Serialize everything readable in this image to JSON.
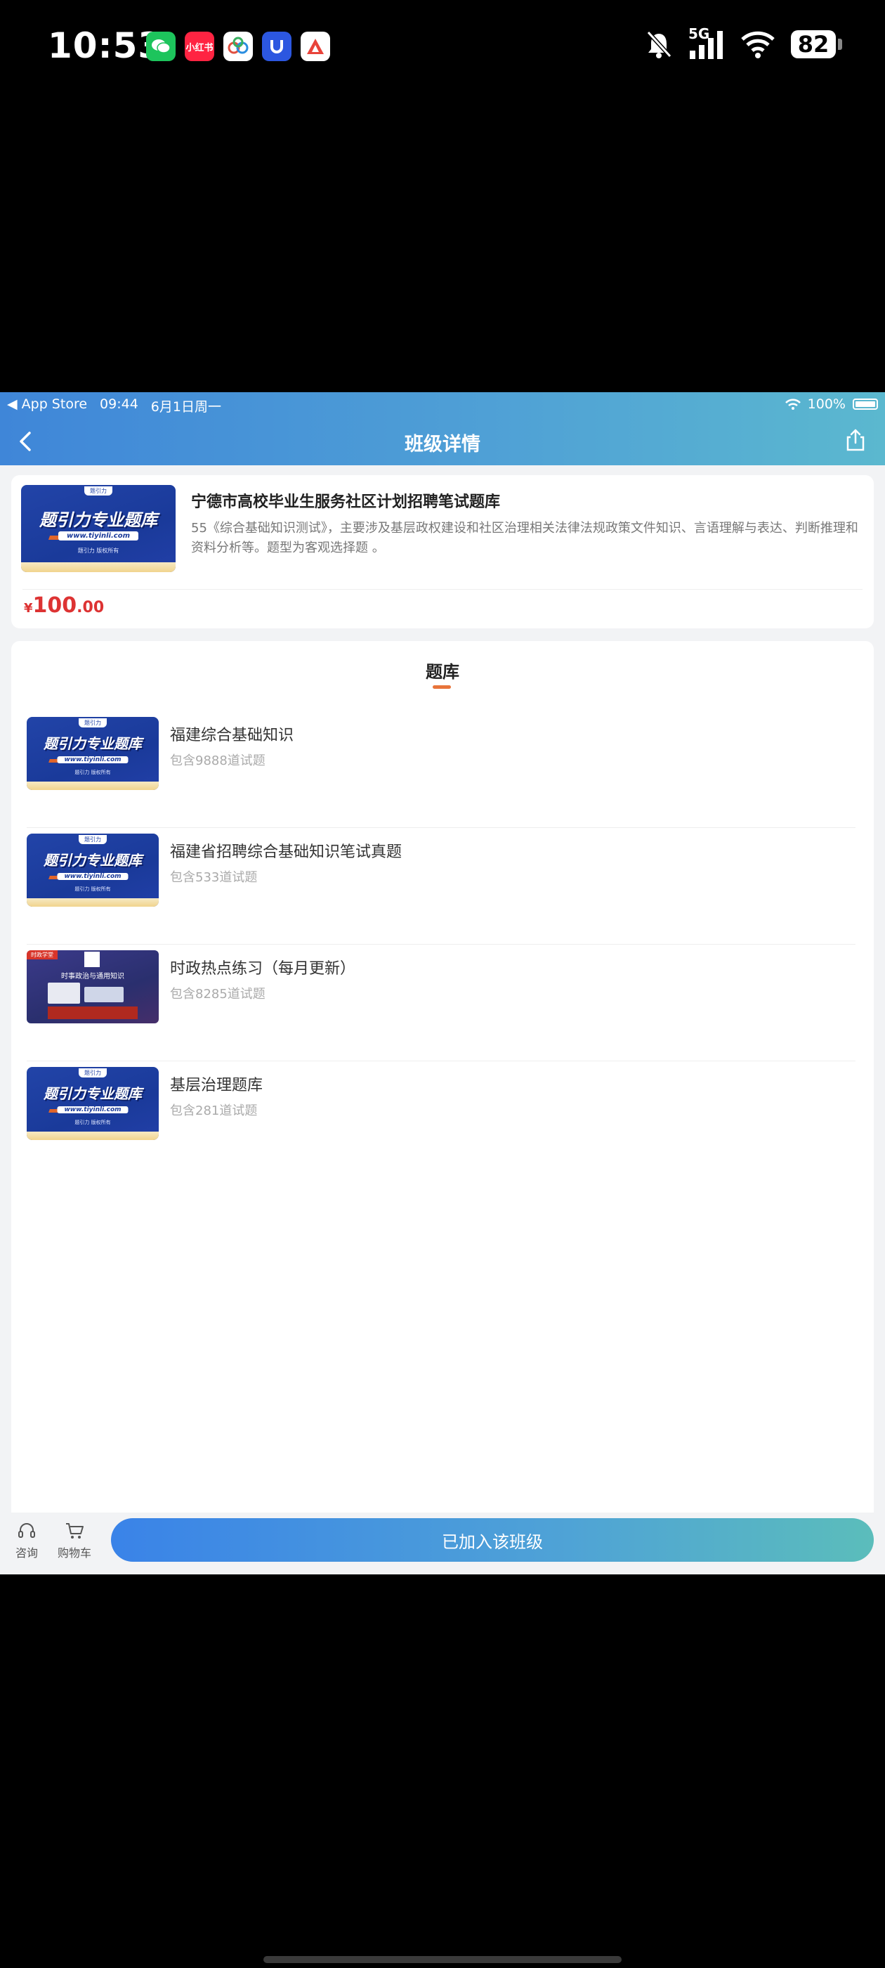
{
  "phone_status": {
    "time": "10:53",
    "apps": [
      {
        "name": "wechat-app-icon",
        "label": "",
        "color": "#1dc45c"
      },
      {
        "name": "xiaohongshu-app-icon",
        "label": "小红书",
        "color": "#ff2442"
      },
      {
        "name": "app-icon-3",
        "label": "",
        "color": "#ffffff"
      },
      {
        "name": "app-icon-4",
        "label": "",
        "color": "#2c57e0"
      },
      {
        "name": "app-icon-5",
        "label": "",
        "color": "#ffffff"
      }
    ],
    "network": "5G",
    "battery": "82"
  },
  "inner_status": {
    "back_app": "◀ App Store",
    "time": "09:44",
    "date": "6月1日周一",
    "battery": "100%"
  },
  "header": {
    "title": "班级详情"
  },
  "course": {
    "title": "宁德市高校毕业生服务社区计划招聘笔试题库",
    "description": "55《综合基础知识测试》，主要涉及基层政权建设和社区治理相关法律法规政策文件知识、言语理解与表达、判断推理和资料分析等。题型为客观选择题 。",
    "price_currency": "¥",
    "price_int": "100",
    "price_dec": ".00",
    "cover": {
      "badge": "题引力",
      "title": "题引力专业题库",
      "url": "www.tiyinli.com",
      "footer": "题引力 版权所有"
    }
  },
  "bank": {
    "heading": "题库",
    "items": [
      {
        "name": "福建综合基础知识",
        "count": "包含9888道试题",
        "cover": "standard"
      },
      {
        "name": "福建省招聘综合基础知识笔试真题",
        "count": "包含533道试题",
        "cover": "standard"
      },
      {
        "name": "时政热点练习（每月更新）",
        "count": "包含8285道试题",
        "cover": "news"
      },
      {
        "name": "基层治理题库",
        "count": "包含281道试题",
        "cover": "standard"
      }
    ],
    "news_cover": {
      "tag": "时政学堂",
      "headline": "时事政治与通用知识"
    }
  },
  "bottom_bar": {
    "consult_label": "咨询",
    "cart_label": "购物车",
    "join_label": "已加入该班级"
  }
}
